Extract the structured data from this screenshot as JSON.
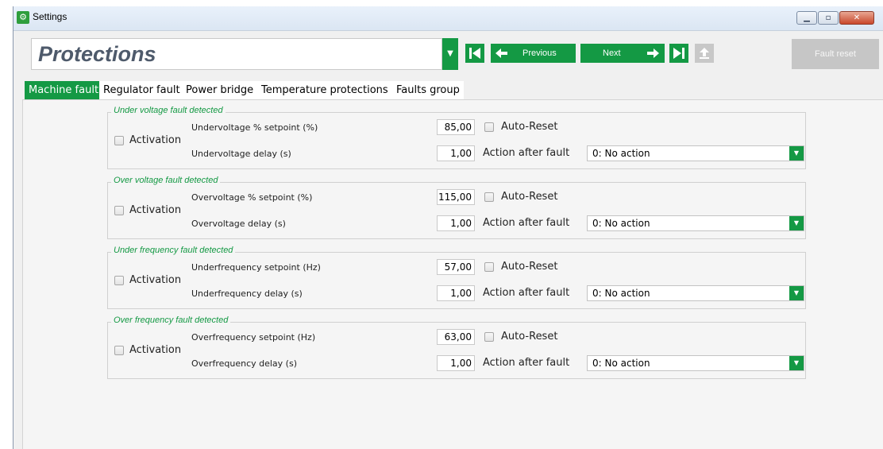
{
  "window": {
    "title": "Settings",
    "icon": "settings-gear-icon",
    "controls": [
      "minimize",
      "maximize",
      "close"
    ]
  },
  "header": {
    "page_title": "Protections",
    "nav": {
      "previous_label": "Previous",
      "next_label": "Next"
    },
    "fault_reset_label": "Fault reset"
  },
  "tabs": [
    {
      "label": "Machine fault",
      "active": true
    },
    {
      "label": "Regulator fault",
      "active": false
    },
    {
      "label": "Power bridge",
      "active": false
    },
    {
      "label": "Temperature protections",
      "active": false
    },
    {
      "label": "Faults group",
      "active": false
    }
  ],
  "groups": [
    {
      "title": "Under voltage fault detected",
      "activation_label": "Activation",
      "setpoint_label": "Undervoltage % setpoint (%)",
      "setpoint_value": "85,00",
      "delay_label": "Undervoltage delay (s)",
      "delay_value": "1,00",
      "auto_reset_label": "Auto-Reset",
      "action_label": "Action after fault",
      "action_value": "0: No action"
    },
    {
      "title": "Over voltage fault detected",
      "activation_label": "Activation",
      "setpoint_label": "Overvoltage % setpoint (%)",
      "setpoint_value": "115,00",
      "delay_label": "Overvoltage delay (s)",
      "delay_value": "1,00",
      "auto_reset_label": "Auto-Reset",
      "action_label": "Action after fault",
      "action_value": "0: No action"
    },
    {
      "title": "Under frequency fault detected",
      "activation_label": "Activation",
      "setpoint_label": "Underfrequency setpoint (Hz)",
      "setpoint_value": "57,00",
      "delay_label": "Underfrequency delay (s)",
      "delay_value": "1,00",
      "auto_reset_label": "Auto-Reset",
      "action_label": "Action after fault",
      "action_value": "0: No action"
    },
    {
      "title": "Over frequency fault detected",
      "activation_label": "Activation",
      "setpoint_label": "Overfrequency setpoint (Hz)",
      "setpoint_value": "63,00",
      "delay_label": "Overfrequency delay (s)",
      "delay_value": "1,00",
      "auto_reset_label": "Auto-Reset",
      "action_label": "Action after fault",
      "action_value": "0: No action"
    }
  ],
  "colors": {
    "accent": "#149944",
    "disabled": "#c6c6c6"
  }
}
